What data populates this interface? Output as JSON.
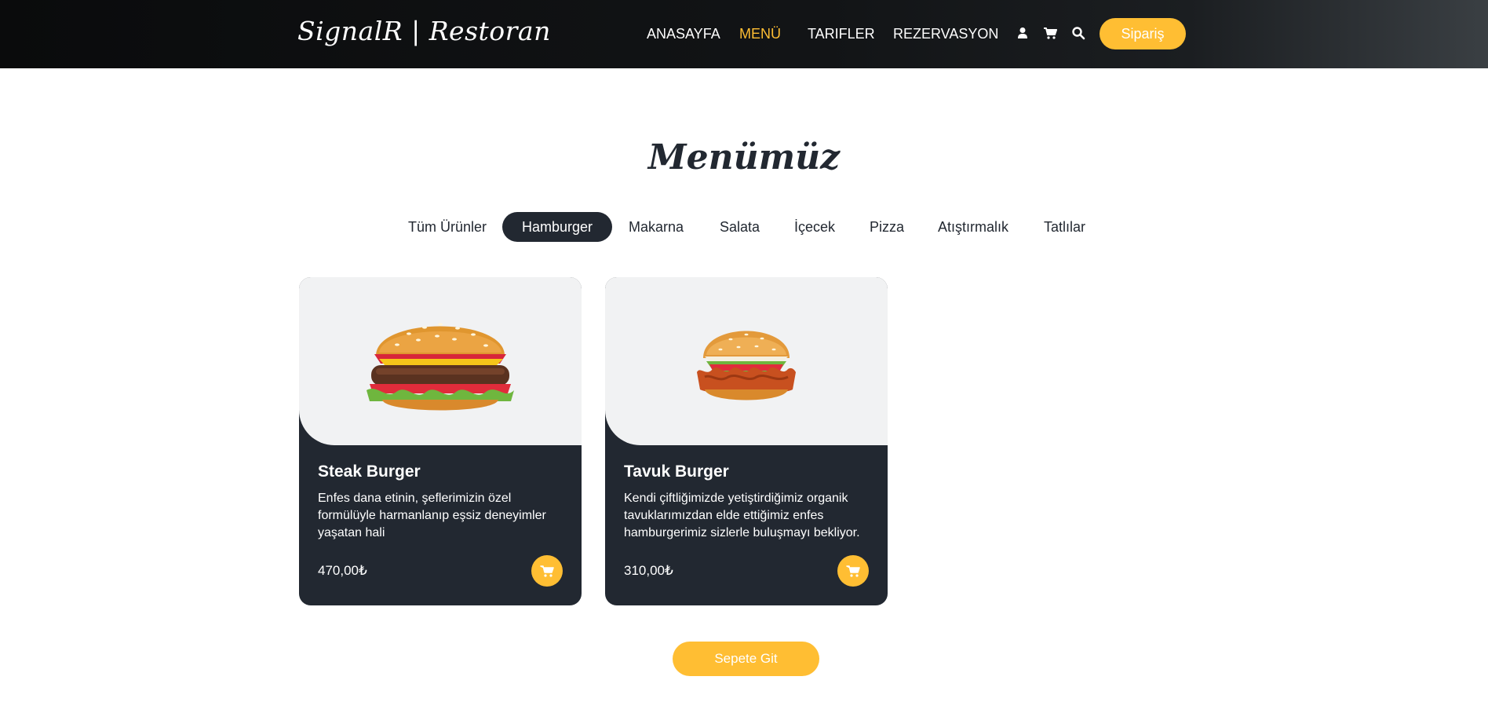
{
  "header": {
    "brand": "SignalR | Restoran",
    "nav": [
      "ANASAYFA",
      "MENÜ",
      "TARIFLER",
      "REZERVASYON"
    ],
    "active_nav": "MENÜ",
    "icons": [
      "user-icon",
      "cart-icon",
      "search-icon"
    ],
    "order_button": "Sipariş"
  },
  "menu": {
    "title": "Menümüz",
    "filters": [
      "Tüm Ürünler",
      "Hamburger",
      "Makarna",
      "Salata",
      "İçecek",
      "Pizza",
      "Atıştırmalık",
      "Tatlılar"
    ],
    "active_filter": "Hamburger"
  },
  "products": [
    {
      "name": "Steak Burger",
      "description": "Enfes dana etinin, şeflerimizin özel formülüyle harmanlanıp eşsiz deneyimler yaşatan hali",
      "price": "470,00₺"
    },
    {
      "name": "Tavuk Burger",
      "description": "Kendi çiftliğimizde yetiştirdiğimiz organik tavuklarımızdan elde ettiğimiz enfes hamburgerimiz sizlerle buluşmayı bekliyor.",
      "price": "310,00₺"
    }
  ],
  "footer_button": "Sepete Git",
  "colors": {
    "accent": "#ffbe33",
    "dark": "#222831"
  }
}
